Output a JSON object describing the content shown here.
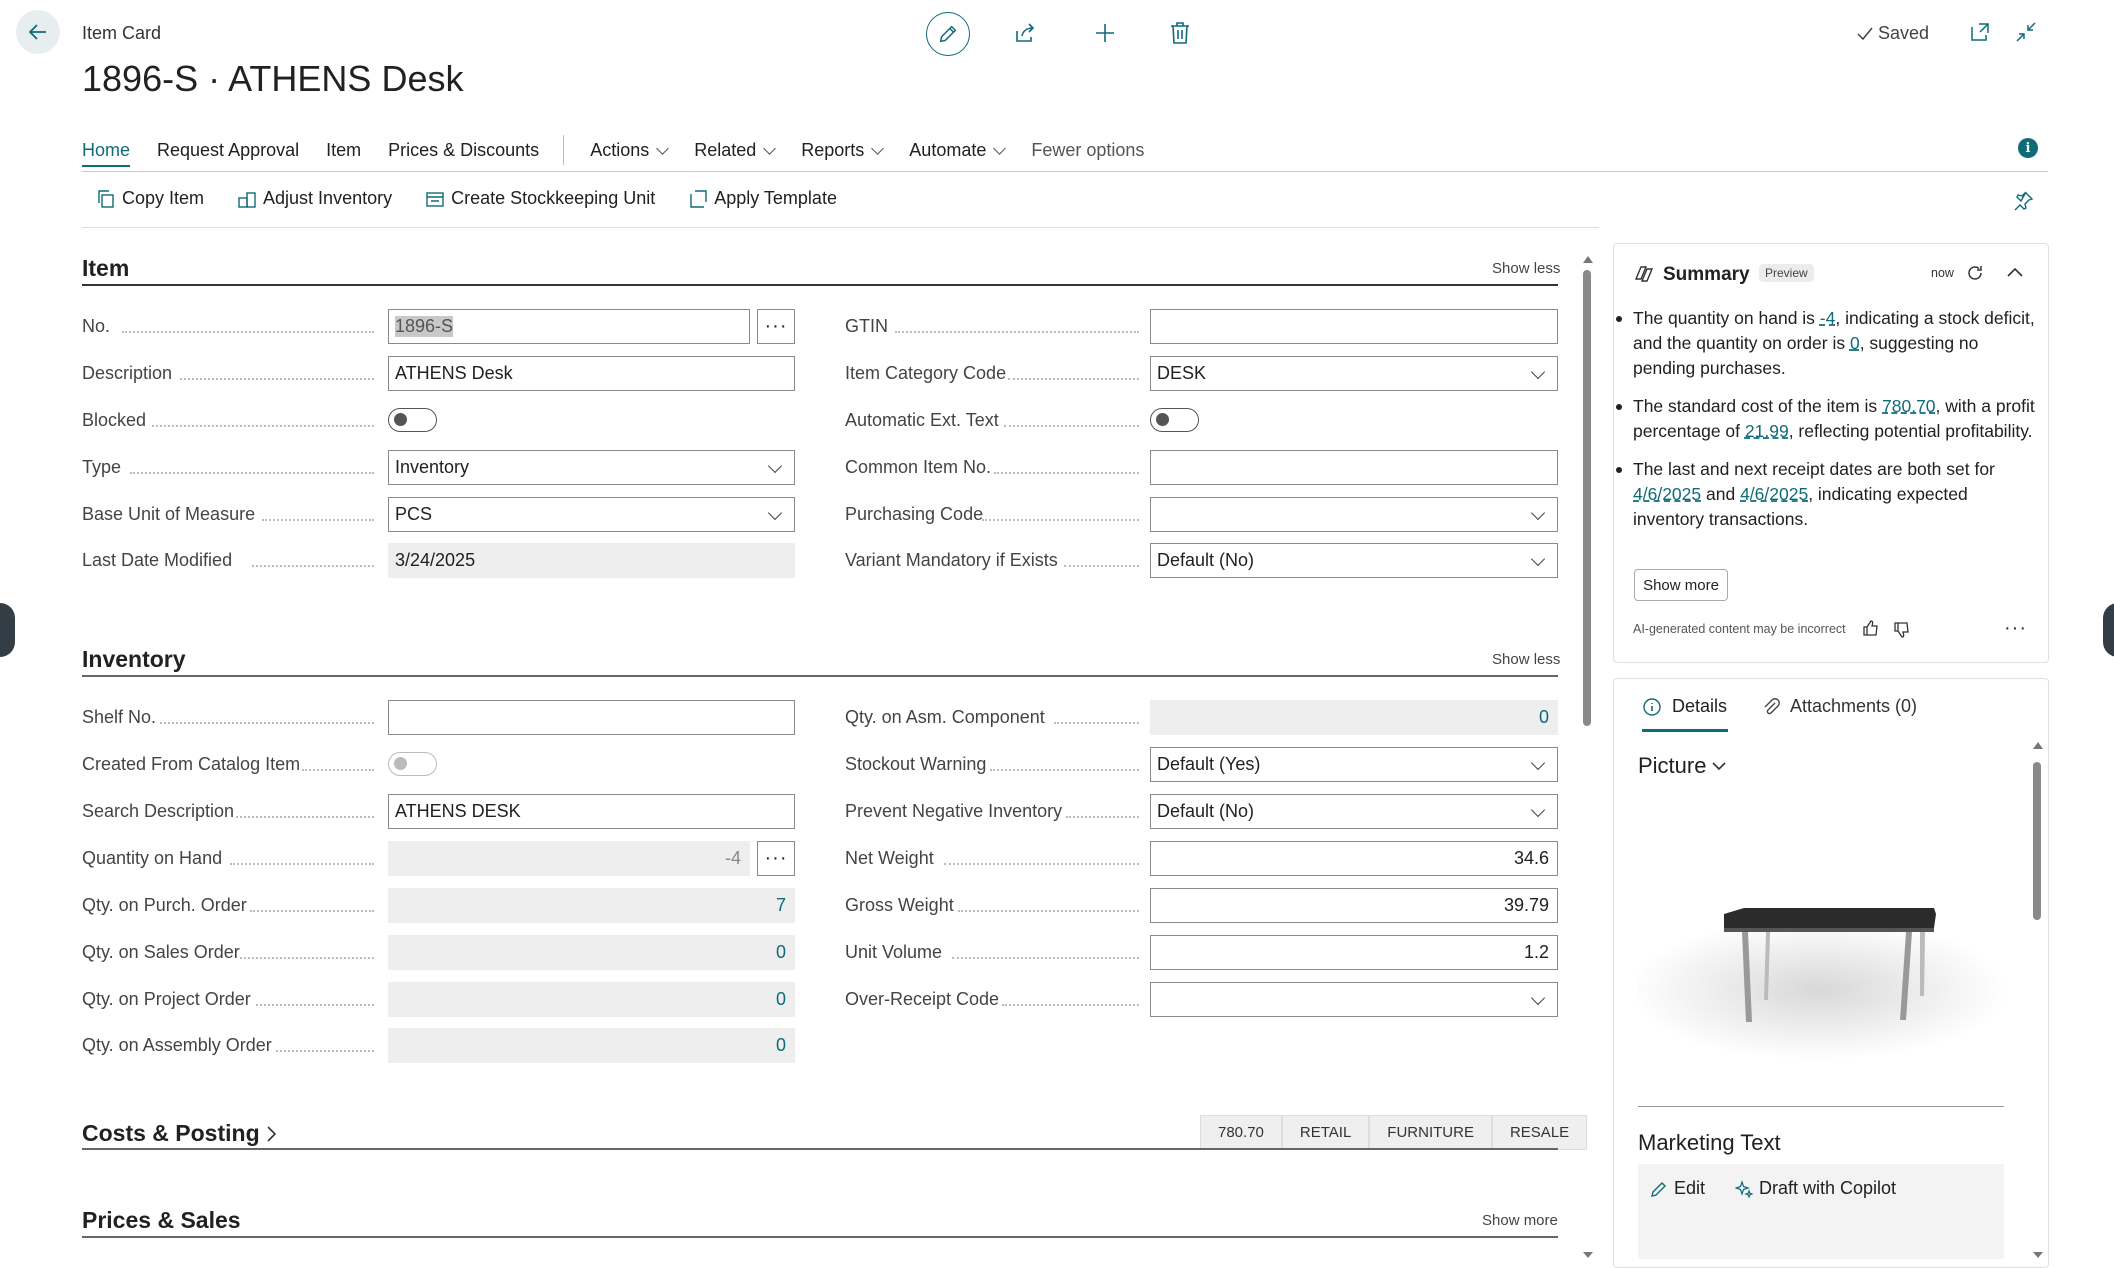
{
  "header": {
    "breadcrumb": "Item Card",
    "title": "1896-S · ATHENS Desk",
    "saved": "Saved"
  },
  "nav": {
    "tabs": [
      "Home",
      "Request Approval",
      "Item",
      "Prices & Discounts"
    ],
    "menus": [
      "Actions",
      "Related",
      "Reports",
      "Automate"
    ],
    "fewer": "Fewer options"
  },
  "actions": [
    "Copy Item",
    "Adjust Inventory",
    "Create Stockkeeping Unit",
    "Apply Template"
  ],
  "item_section": {
    "title": "Item",
    "toggle": "Show less",
    "left": {
      "no_label": "No.",
      "no_value": "1896-S",
      "desc_label": "Description",
      "desc_value": "ATHENS Desk",
      "blocked_label": "Blocked",
      "type_label": "Type",
      "type_value": "Inventory",
      "uom_label": "Base Unit of Measure",
      "uom_value": "PCS",
      "ldm_label": "Last Date Modified",
      "ldm_value": "3/24/2025"
    },
    "right": {
      "gtin_label": "GTIN",
      "gtin_value": "",
      "cat_label": "Item Category Code",
      "cat_value": "DESK",
      "aet_label": "Automatic Ext. Text",
      "common_label": "Common Item No.",
      "common_value": "",
      "purch_label": "Purchasing Code",
      "purch_value": "",
      "variant_label": "Variant Mandatory if Exists",
      "variant_value": "Default (No)"
    }
  },
  "inventory_section": {
    "title": "Inventory",
    "toggle": "Show less",
    "left": {
      "shelf_label": "Shelf No.",
      "shelf_value": "",
      "catalog_label": "Created From Catalog Item",
      "search_label": "Search Description",
      "search_value": "ATHENS DESK",
      "qoh_label": "Quantity on Hand",
      "qoh_value": "-4",
      "qpo_label": "Qty. on Purch. Order",
      "qpo_value": "7",
      "qso_label": "Qty. on Sales Order",
      "qso_value": "0",
      "qproj_label": "Qty. on Project Order",
      "qproj_value": "0",
      "qasm_label": "Qty. on Assembly Order",
      "qasm_value": "0"
    },
    "right": {
      "asmc_label": "Qty. on Asm. Component",
      "asmc_value": "0",
      "stock_label": "Stockout Warning",
      "stock_value": "Default (Yes)",
      "neg_label": "Prevent Negative Inventory",
      "neg_value": "Default (No)",
      "net_label": "Net Weight",
      "net_value": "34.6",
      "gross_label": "Gross Weight",
      "gross_value": "39.79",
      "vol_label": "Unit Volume",
      "vol_value": "1.2",
      "over_label": "Over-Receipt Code",
      "over_value": ""
    }
  },
  "costs_section": {
    "title": "Costs & Posting",
    "tags": [
      "780.70",
      "RETAIL",
      "FURNITURE",
      "RESALE"
    ]
  },
  "prices_section": {
    "title": "Prices & Sales",
    "toggle": "Show more"
  },
  "summary": {
    "title": "Summary",
    "badge": "Preview",
    "time": "now",
    "b1_a": "The quantity on hand is ",
    "b1_l1": "-4",
    "b1_b": ", indicating a stock deficit, and the quantity on order is ",
    "b1_l2": "0",
    "b1_c": ", suggesting no pending purchases.",
    "b2_a": "The standard cost of the item is ",
    "b2_l1": "780.70",
    "b2_b": ", with a profit percentage of ",
    "b2_l2": "21.99",
    "b2_c": ", reflecting potential profitability.",
    "b3_a": "The last and next receipt dates are both set for ",
    "b3_l1": "4/6/2025",
    "b3_b": " and ",
    "b3_l2": "4/6/2025",
    "b3_c": ", indicating expected inventory transactions.",
    "show_more": "Show more",
    "disclaimer": "AI-generated content may be incorrect"
  },
  "details": {
    "tab_details": "Details",
    "tab_attachments": "Attachments (0)",
    "picture": "Picture",
    "marketing": "Marketing Text",
    "edit": "Edit",
    "draft": "Draft with Copilot"
  },
  "colors": {
    "accent": "#0f6b78"
  }
}
